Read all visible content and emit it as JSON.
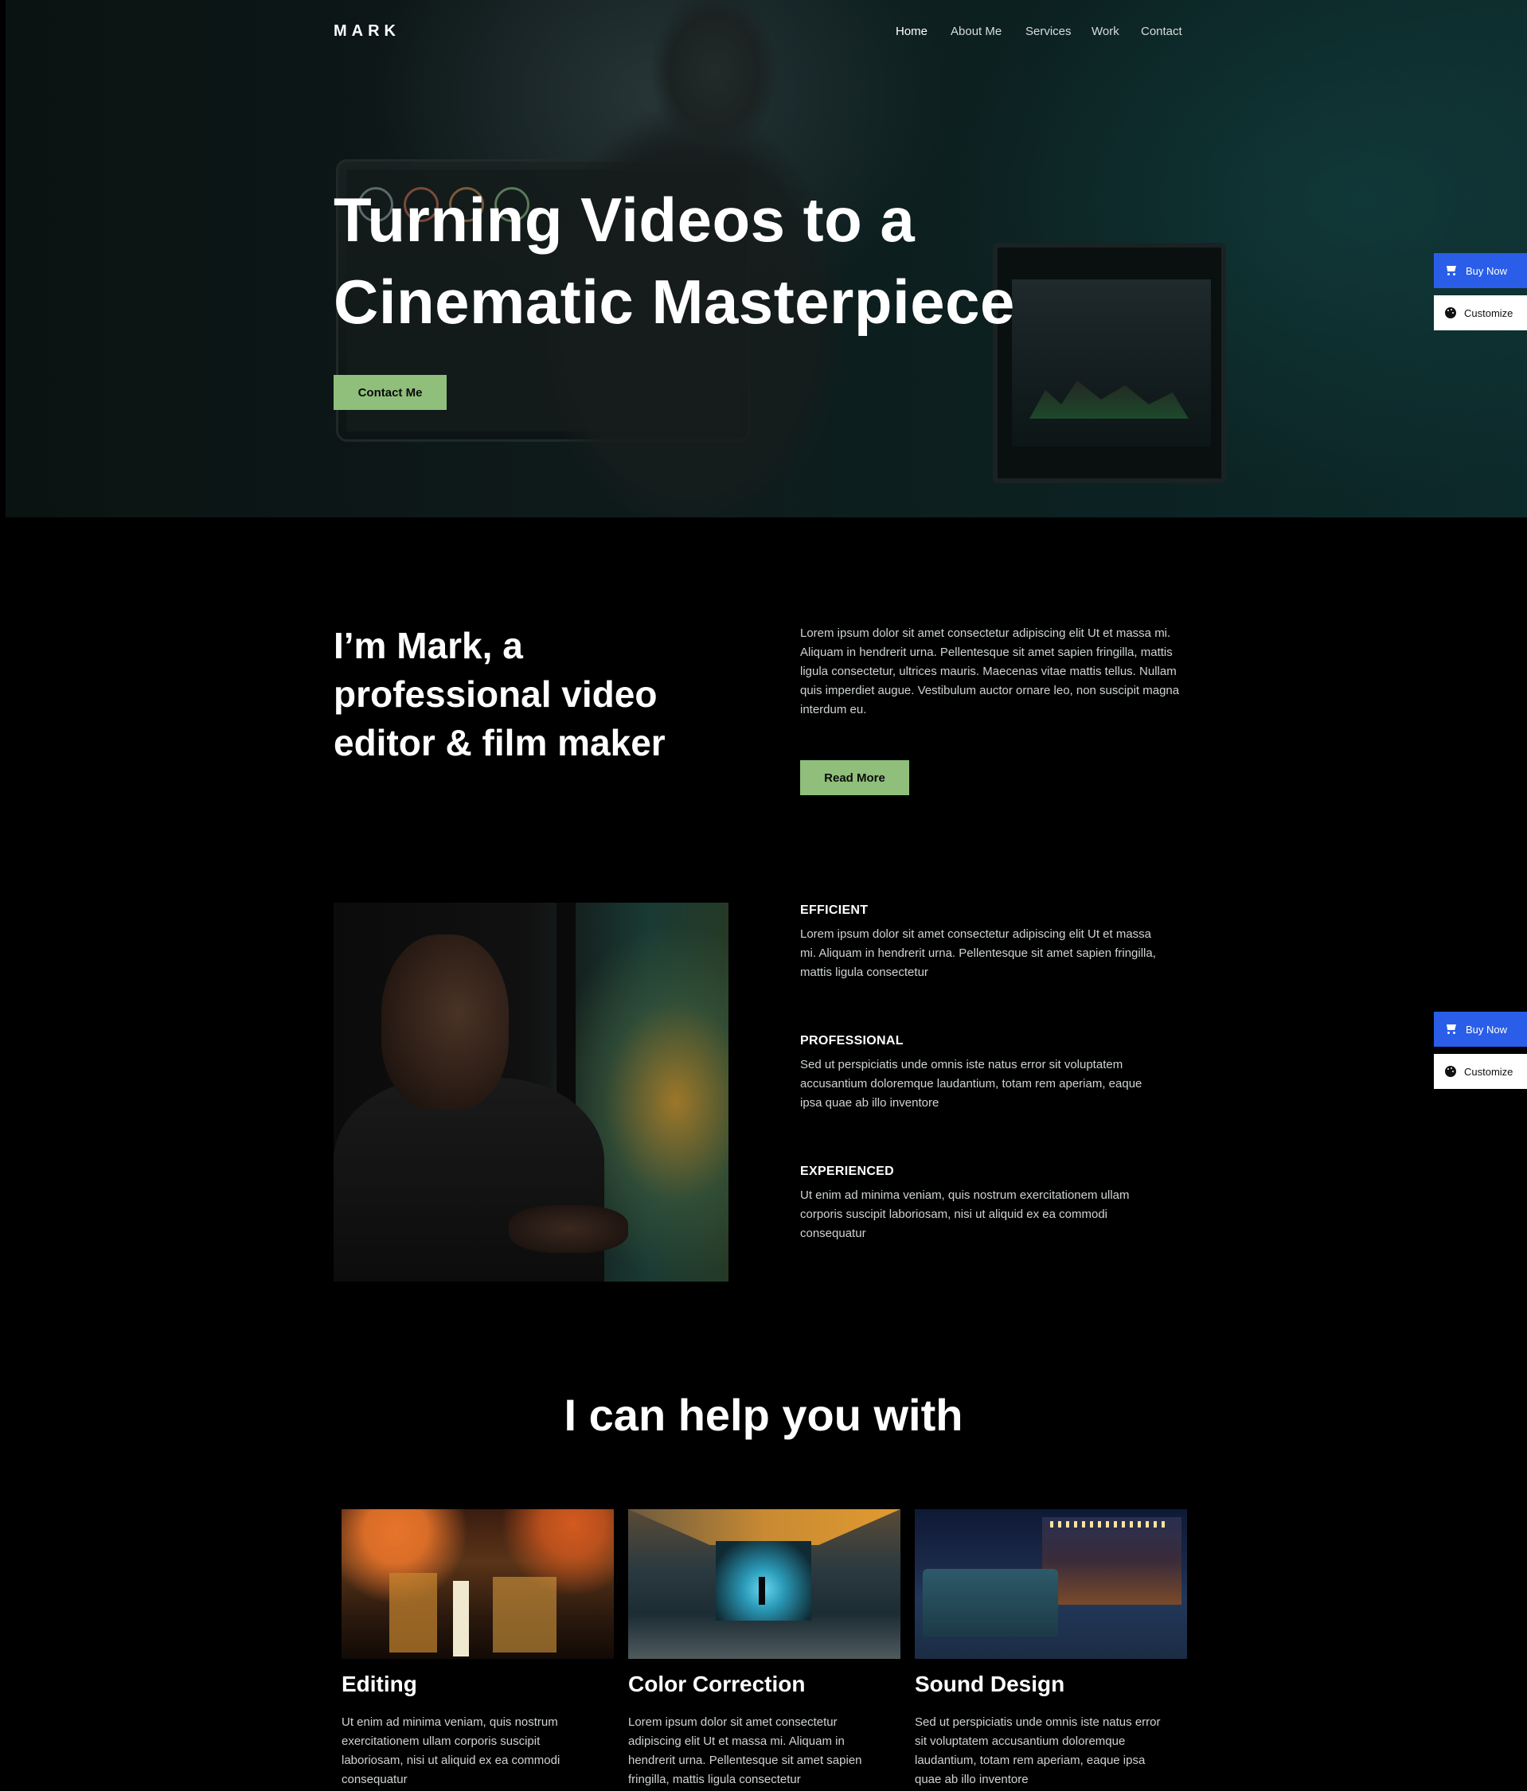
{
  "header": {
    "logo": "MARK",
    "nav": [
      "Home",
      "About Me",
      "Services",
      "Work",
      "Contact"
    ]
  },
  "hero": {
    "title_line1": "Turning Videos to a",
    "title_line2": "Cinematic Masterpiece",
    "cta": "Contact Me"
  },
  "widgets": {
    "buy_now": "Buy Now",
    "customize": "Customize"
  },
  "about": {
    "title": "I’m Mark, a professional video editor & film maker",
    "text": "Lorem ipsum dolor sit amet consectetur adipiscing elit Ut et massa mi. Aliquam in hendrerit urna. Pellentesque sit amet sapien fringilla, mattis ligula consectetur, ultrices mauris. Maecenas vitae mattis tellus. Nullam quis imperdiet augue. Vestibulum auctor ornare leo, non suscipit magna interdum eu.",
    "button": "Read More"
  },
  "features": [
    {
      "title": "EFFICIENT",
      "text": "Lorem ipsum dolor sit amet consectetur adipiscing elit Ut et massa mi. Aliquam in hendrerit urna. Pellentesque sit amet sapien fringilla, mattis ligula consectetur"
    },
    {
      "title": "PROFESSIONAL",
      "text": "Sed ut perspiciatis unde omnis iste natus error sit voluptatem accusantium doloremque laudantium, totam rem aperiam, eaque ipsa quae ab illo inventore"
    },
    {
      "title": "EXPERIENCED",
      "text": "Ut enim ad minima veniam, quis nostrum exercitationem ullam corporis suscipit laboriosam, nisi ut aliquid ex ea commodi consequatur"
    }
  ],
  "services": {
    "title": "I can help you with",
    "cards": [
      {
        "title": "Editing",
        "text": "Ut enim ad minima veniam, quis nostrum exercitationem ullam corporis suscipit laboriosam, nisi ut aliquid ex ea commodi consequatur"
      },
      {
        "title": "Color Correction",
        "text": "Lorem ipsum dolor sit amet consectetur adipiscing elit Ut et massa mi. Aliquam in hendrerit urna. Pellentesque sit amet sapien fringilla, mattis ligula consectetur"
      },
      {
        "title": "Sound Design",
        "text": "Sed ut perspiciatis unde omnis iste natus error sit voluptatem accusantium doloremque laudantium, totam rem aperiam, eaque ipsa quae ab illo inventore"
      }
    ]
  },
  "colors": {
    "accent_green": "#8fbf7a",
    "buy_blue": "#2a5ee8",
    "background": "#000000"
  }
}
